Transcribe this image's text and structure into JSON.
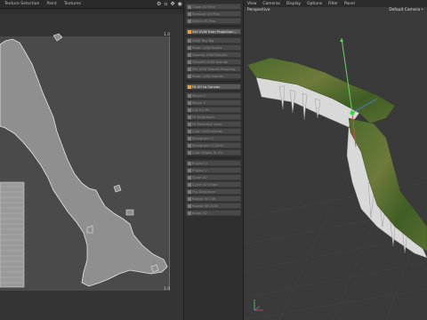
{
  "uv_editor": {
    "menu": [
      "Texture Selection",
      "Paint",
      "Textures"
    ],
    "tool_icons": [
      "gear-icon",
      "lock-icon",
      "move-icon",
      "zoom-icon",
      "fit-icon"
    ],
    "corner_top_right": "1.0",
    "corner_bottom_right": "1.0"
  },
  "command_panel": {
    "group1": [
      {
        "label": "Close UV Pins",
        "icon": "checker-icon"
      },
      {
        "label": "Remove UV Pins",
        "icon": "checker-icon"
      },
      {
        "label": "Stitch UV Pins",
        "icon": "checker-icon"
      }
    ],
    "highlight1": {
      "label": "Set UVW from Projection...",
      "icon": "grid-icon"
    },
    "group2": [
      {
        "label": "UVW Tag Tag"
      },
      {
        "label": "Relax UVW Seeds"
      },
      {
        "label": "Unwrap UVW Islands"
      },
      {
        "label": "Transfer UVW Islands"
      },
      {
        "label": "Set UVW Islands Mapping"
      },
      {
        "label": "Relax UVW Islands"
      }
    ],
    "highlight2": {
      "label": "Fit UV to Canvas",
      "icon": "grid-icon"
    },
    "group3": [
      {
        "label": "Mirror U"
      },
      {
        "label": "Mirror V"
      },
      {
        "label": "Cut UV Fill"
      },
      {
        "label": "Fit Neighbors"
      },
      {
        "label": "Fit Selection Area"
      },
      {
        "label": "Align UVW Islands"
      },
      {
        "label": "Straighten U"
      },
      {
        "label": "Straighten V (Grid)"
      },
      {
        "label": "Align Edges To UV"
      }
    ],
    "group4": [
      {
        "label": "Project U"
      },
      {
        "label": "Project V"
      },
      {
        "label": "Scale UV"
      },
      {
        "label": "Cycle UV Order"
      },
      {
        "label": "Flip Sequence"
      },
      {
        "label": "Rotate 90 CW"
      },
      {
        "label": "Rotate 90 CCW"
      },
      {
        "label": "Relax UV"
      }
    ]
  },
  "viewport": {
    "menu": [
      "View",
      "Cameras",
      "Display",
      "Options",
      "Filter",
      "Panel"
    ],
    "view_name": "Perspective",
    "camera": "Default Camera •"
  }
}
